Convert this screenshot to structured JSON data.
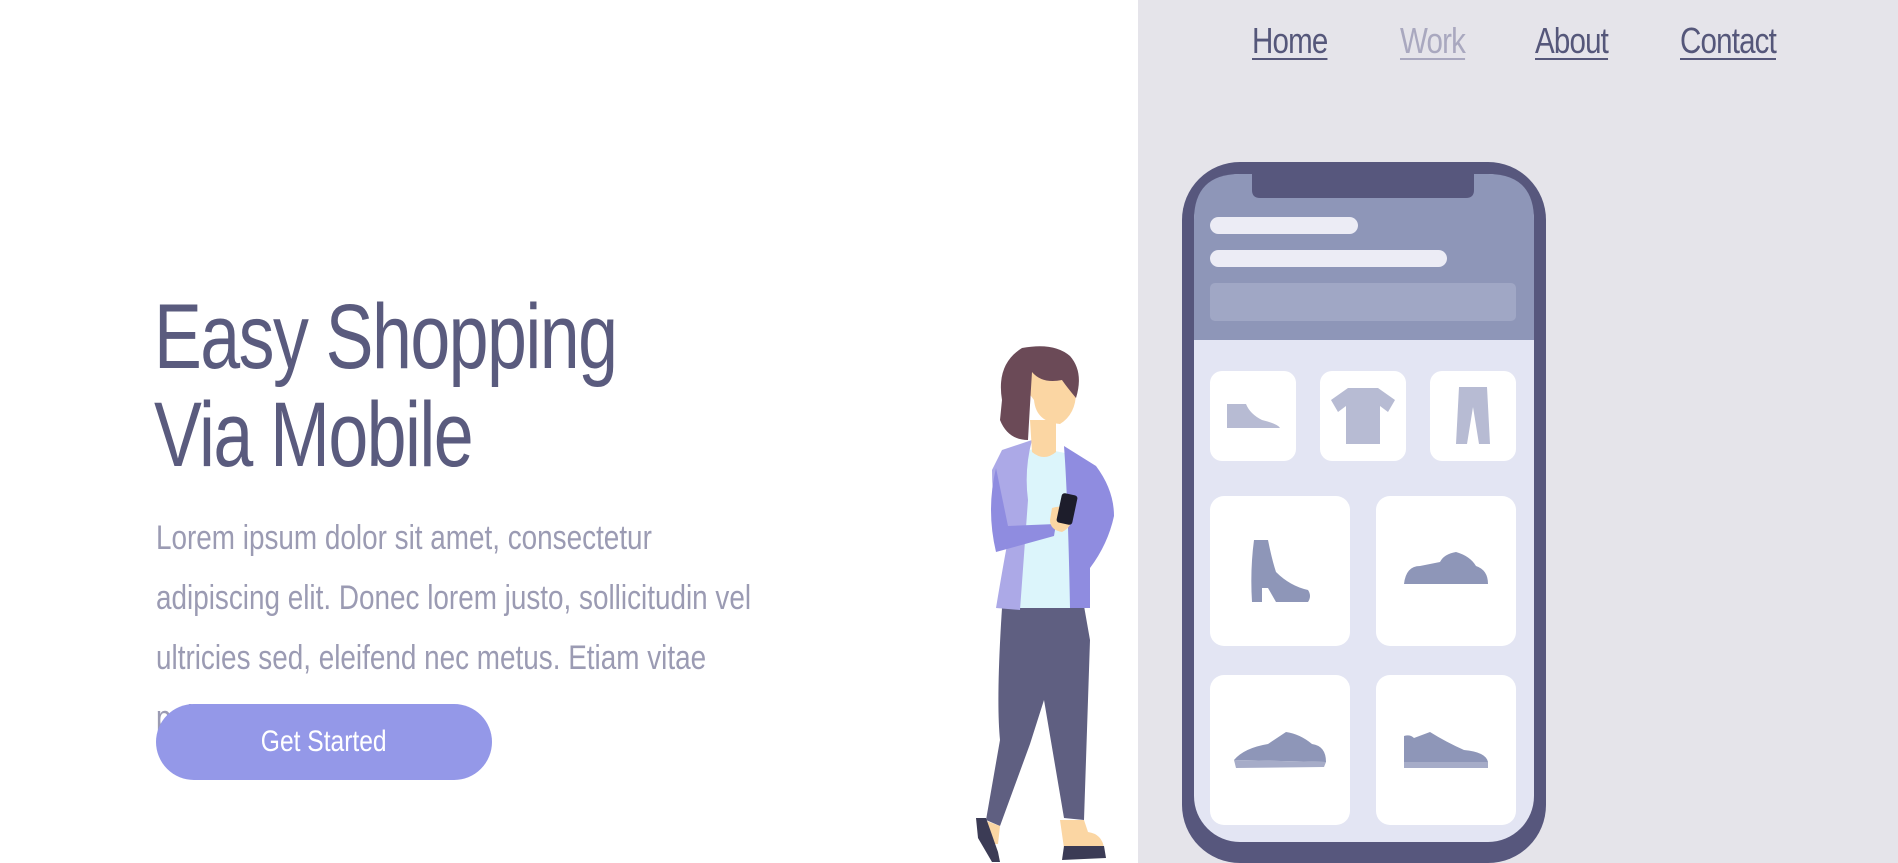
{
  "nav": {
    "items": [
      {
        "label": "Home",
        "active": false
      },
      {
        "label": "Work",
        "active": true
      },
      {
        "label": "About",
        "active": false
      },
      {
        "label": "Contact",
        "active": false
      }
    ]
  },
  "hero": {
    "title_line1": "Easy Shopping",
    "title_line2": "Via Mobile",
    "description": "Lorem ipsum dolor sit amet, consectetur adipiscing elit. Donec lorem justo, sollicitudin vel ultricies sed, eleifend nec metus. Etiam vitae pellentesque dolor.",
    "cta_label": "Get Started"
  },
  "colors": {
    "background": "#ffffff",
    "panel": "#e5e4ea",
    "heading": "#5a5b7e",
    "body_text": "#9b9bb3",
    "accent": "#9498e8",
    "nav_active": "#a9a8bf"
  },
  "phone": {
    "products": [
      "shoe-icon",
      "tshirt-icon",
      "pants-icon",
      "boot-icon",
      "sneaker-icon",
      "sneaker-icon",
      "sneaker-icon"
    ]
  }
}
